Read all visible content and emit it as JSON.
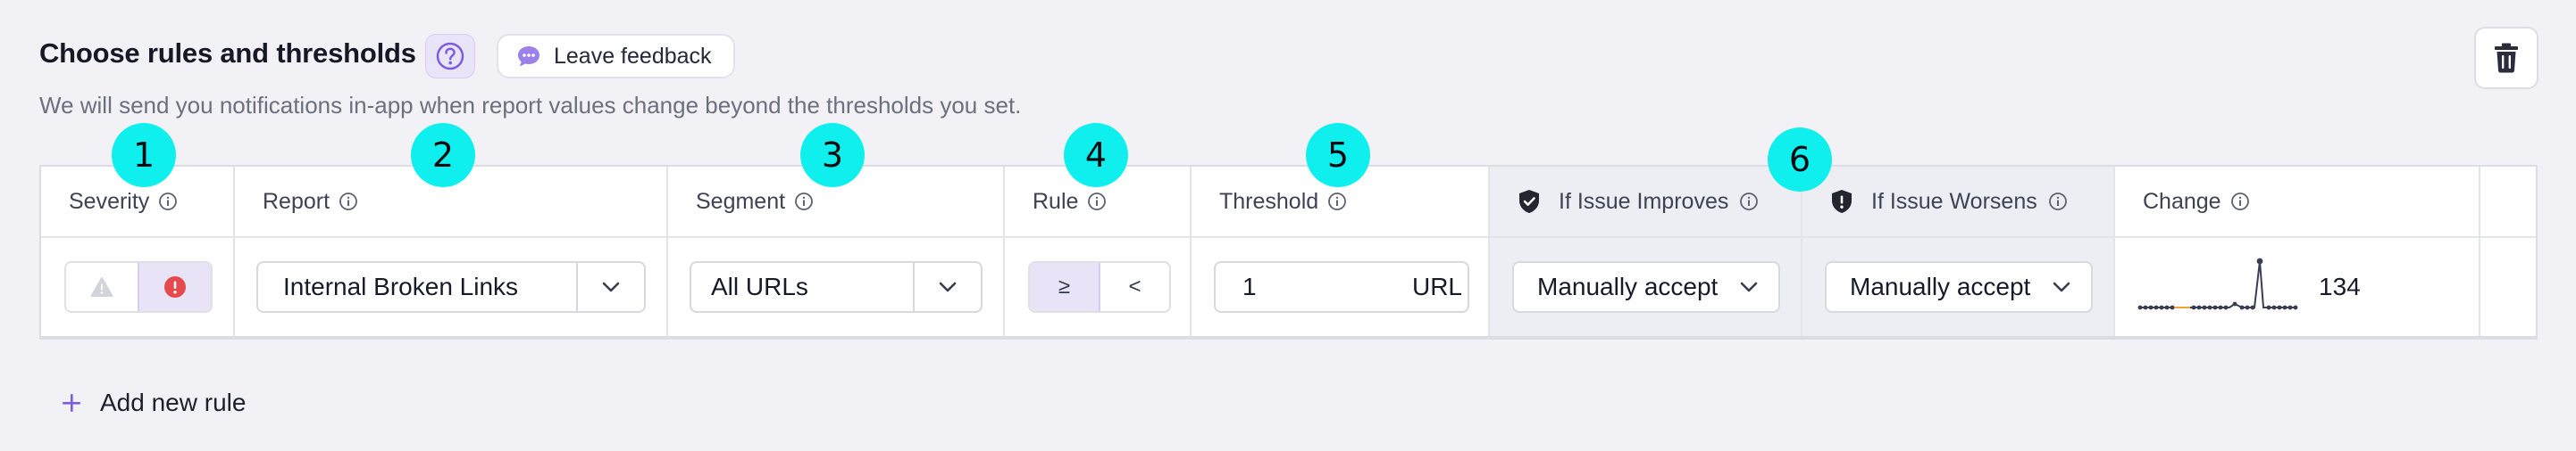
{
  "header": {
    "title": "Choose rules and thresholds",
    "feedback_label": "Leave feedback",
    "subtitle": "We will send you notifications in-app when report values change beyond the thresholds you set."
  },
  "table": {
    "columns": {
      "severity": "Severity",
      "report": "Report",
      "segment": "Segment",
      "rule": "Rule",
      "threshold": "Threshold",
      "improves": "If Issue Improves",
      "worsens": "If Issue Worsens",
      "change": "Change"
    },
    "row": {
      "report": "Internal Broken Links",
      "segment": "All URLs",
      "rule_options": [
        "≥",
        "<"
      ],
      "threshold_value": "1",
      "threshold_unit": "URL",
      "improves": "Manually accept",
      "worsens": "Manually accept",
      "change": "134"
    }
  },
  "add_rule_label": "Add new rule",
  "markers": [
    "1",
    "2",
    "3",
    "4",
    "5",
    "6"
  ],
  "colors": {
    "accent": "#7c5ce0",
    "danger": "#e5484d",
    "marker": "#0ff0ee"
  },
  "icons": [
    "question-icon",
    "chat-bubble-icon",
    "trash-icon",
    "info-icon",
    "warning-icon",
    "error-icon",
    "chevron-down-icon",
    "shield-check-icon",
    "shield-alert-icon",
    "plus-icon"
  ]
}
